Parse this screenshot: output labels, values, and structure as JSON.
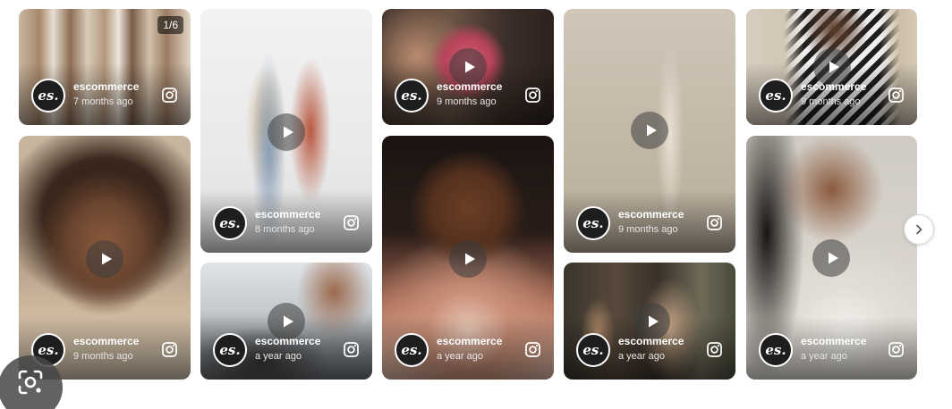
{
  "gallery": {
    "counter": "1/6",
    "next_icon": "chevron-right-icon",
    "lens_icon": "camera-search-icon",
    "avatar_text": "es.",
    "cards": [
      {
        "id": "c1",
        "username": "escommerce",
        "time": "7 months ago",
        "has_play": false,
        "has_counter": true
      },
      {
        "id": "c2",
        "username": "escommerce",
        "time": "9 months ago",
        "has_play": true
      },
      {
        "id": "c3",
        "username": "escommerce",
        "time": "8 months ago",
        "has_play": true
      },
      {
        "id": "c4",
        "username": "escommerce",
        "time": "a year ago",
        "has_play": true
      },
      {
        "id": "c5",
        "username": "escommerce",
        "time": "9 months ago",
        "has_play": true
      },
      {
        "id": "c6",
        "username": "escommerce",
        "time": "a year ago",
        "has_play": true
      },
      {
        "id": "c7",
        "username": "escommerce",
        "time": "9 months ago",
        "has_play": true
      },
      {
        "id": "c8",
        "username": "escommerce",
        "time": "a year ago",
        "has_play": true
      },
      {
        "id": "c9",
        "username": "escommerce",
        "time": "9 months ago",
        "has_play": true
      },
      {
        "id": "c10",
        "username": "escommerce",
        "time": "a year ago",
        "has_play": true
      }
    ]
  }
}
